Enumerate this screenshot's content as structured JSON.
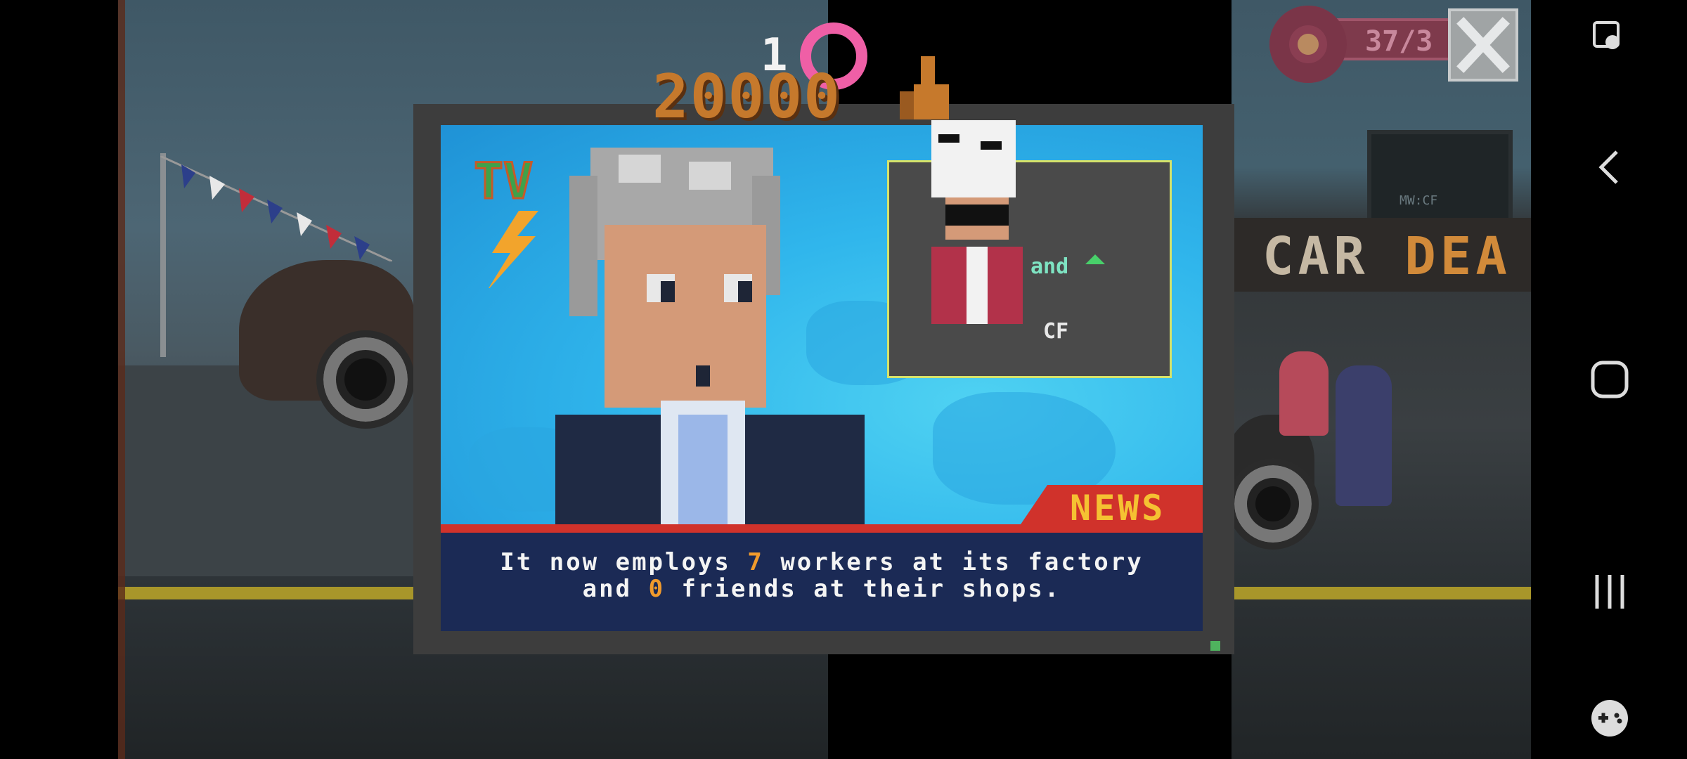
{
  "hud": {
    "donut_counter": "37/3",
    "floating_reward": "1",
    "score": "20000"
  },
  "tv": {
    "logo": "TV",
    "news_label": "NEWS",
    "caption": {
      "line1_pre": "It now employs ",
      "workers": "7",
      "line1_post": " workers at its factory",
      "line2_pre": "and ",
      "friends": "0",
      "line2_post": " friends at their shops."
    },
    "inset": {
      "and_label": "and",
      "cf_label": "CF"
    }
  },
  "background": {
    "sign_part1": "CAR ",
    "sign_part2": "DEA",
    "window_label": "MW:CF"
  },
  "nav": {
    "icons": [
      "screen-touch-icon",
      "back-icon",
      "home-icon",
      "recents-icon",
      "game-tools-icon"
    ]
  },
  "colors": {
    "highlight": "#f09a2c",
    "news_red": "#d0322b",
    "news_yellow": "#f5c132",
    "caption_bg": "#1b2a55"
  }
}
